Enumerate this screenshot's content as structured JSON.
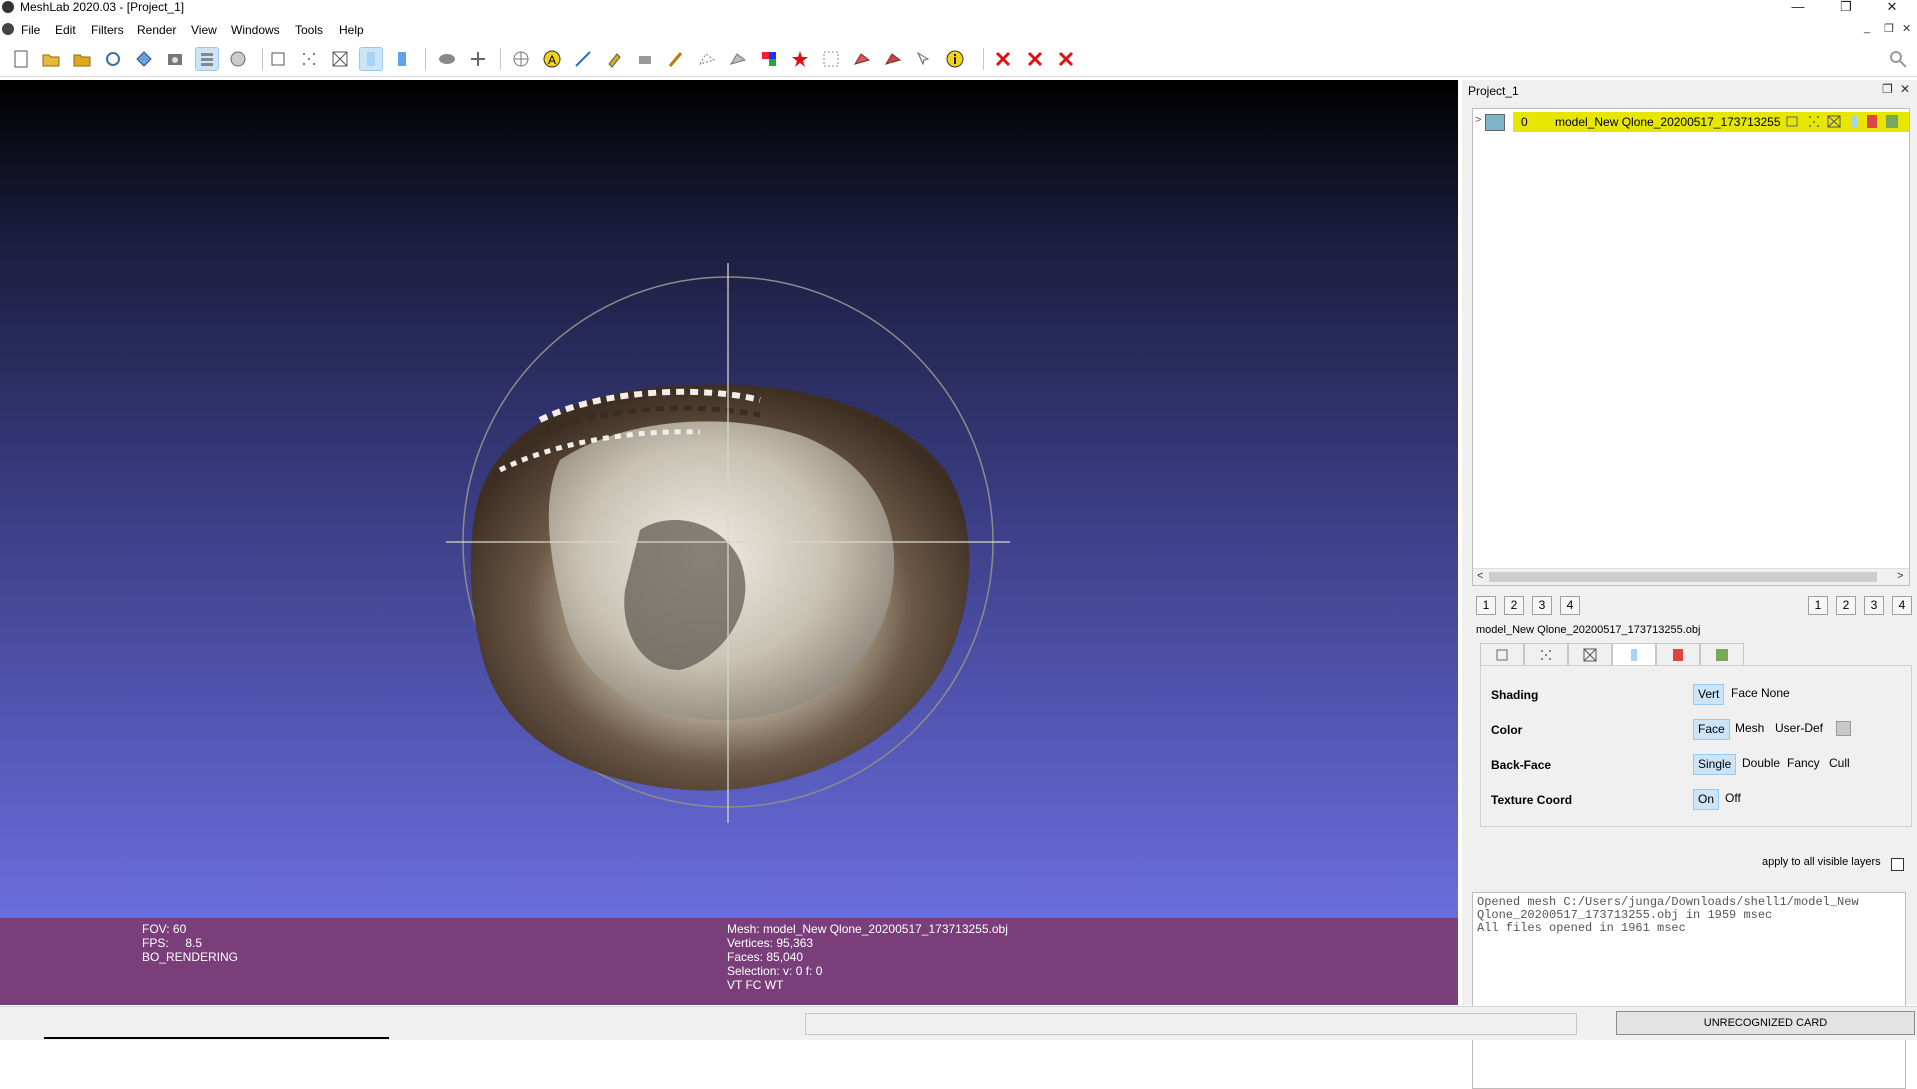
{
  "window": {
    "title": "MeshLab 2020.03 - [Project_1]",
    "minimize_glyph": "—",
    "restore_glyph": "❐",
    "close_glyph": "✕"
  },
  "menu": {
    "items": [
      "File",
      "Edit",
      "Filters",
      "Render",
      "View",
      "Windows",
      "Tools",
      "Help"
    ],
    "mdi_controls": [
      "_",
      "❐",
      "✕"
    ]
  },
  "toolbar": {
    "icons": [
      "new-project",
      "open",
      "open-folder",
      "reload",
      "save",
      "snapshot",
      "layers",
      "trackball",
      "bounding-box",
      "points",
      "wireframe",
      "flat",
      "smooth",
      "light",
      "axis",
      "sphere",
      "annotation",
      "measure",
      "paint",
      "brush",
      "select-vertex",
      "select-face",
      "color",
      "georef",
      "select-region",
      "delete-faces",
      "delete-vertices",
      "pick",
      "info",
      "close-x",
      "close-x-2",
      "close-x-3"
    ],
    "search_icon": "search-icon"
  },
  "viewport": {
    "info_left": [
      "FOV: 60",
      "FPS:     8.5",
      "BO_RENDERING"
    ],
    "info_center": [
      "Mesh: model_New Qlone_20200517_173713255.obj",
      "Vertices: 95,363",
      "Faces: 85,040",
      "Selection: v: 0 f: 0",
      "VT FC WT"
    ]
  },
  "panel": {
    "title": "Project_1",
    "layer": {
      "index": "0",
      "name": "model_New Qlone_20200517_173713255"
    },
    "left_buttons": [
      "1",
      "2",
      "3",
      "4"
    ],
    "right_buttons": [
      "1",
      "2",
      "3",
      "4"
    ],
    "mesh_file": "model_New Qlone_20200517_173713255.obj",
    "render": {
      "shading": {
        "label": "Shading",
        "options": [
          "Vert",
          "Face",
          "None"
        ],
        "selected": "Vert"
      },
      "color": {
        "label": "Color",
        "options": [
          "Face",
          "Mesh",
          "User-Def"
        ],
        "selected": "Face"
      },
      "backface": {
        "label": "Back-Face",
        "options": [
          "Single",
          "Double",
          "Fancy",
          "Cull"
        ],
        "selected": "Single"
      },
      "texture": {
        "label": "Texture Coord",
        "options": [
          "On",
          "Off"
        ],
        "selected": "On"
      }
    },
    "apply_all_label": "apply to all visible layers",
    "log": "Opened mesh C:/Users/junga/Downloads/shell1/model_New Qlone_20200517_173713255.obj in 1959 msec\nAll files opened in 1961 msec"
  },
  "statusbar": {
    "card_text": "UNRECOGNIZED CARD"
  },
  "colors": {
    "layer_highlight": "#e6e600",
    "info_bar": "#7a3f7b",
    "selected_option": "#cce4f7"
  }
}
